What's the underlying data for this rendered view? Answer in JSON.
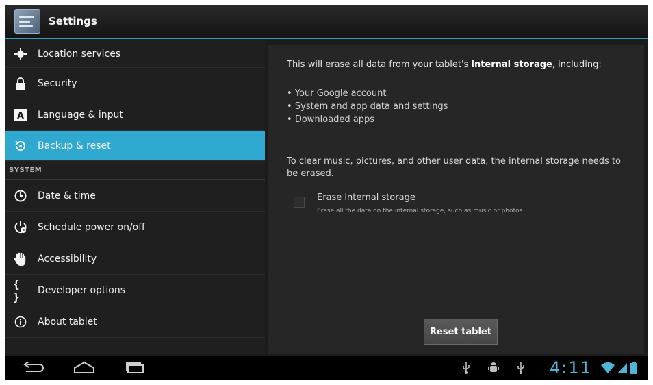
{
  "app": {
    "title": "Settings"
  },
  "sidebar": {
    "items": [
      {
        "label": "Location services",
        "icon": "location-icon"
      },
      {
        "label": "Security",
        "icon": "lock-icon"
      },
      {
        "label": "Language & input",
        "icon": "keyboard-a-icon"
      },
      {
        "label": "Backup & reset",
        "icon": "backup-icon",
        "selected": true
      }
    ],
    "system_header": "SYSTEM",
    "system_items": [
      {
        "label": "Date & time",
        "icon": "clock-icon"
      },
      {
        "label": "Schedule power on/off",
        "icon": "schedule-power-icon"
      },
      {
        "label": "Accessibility",
        "icon": "hand-icon"
      },
      {
        "label": "Developer options",
        "icon": "braces-icon"
      },
      {
        "label": "About tablet",
        "icon": "info-icon"
      }
    ]
  },
  "main": {
    "intro_prefix": "This will erase all data from your tablet's ",
    "intro_bold": "internal storage",
    "intro_suffix": ", including:",
    "bullets": [
      "Your Google account",
      "System and app data and settings",
      "Downloaded apps"
    ],
    "note": "To clear music, pictures, and other user data, the internal storage needs to be erased.",
    "erase_title": "Erase internal storage",
    "erase_subtitle": "Erase all the data on the internal storage, such as music or photos",
    "reset_button": "Reset tablet"
  },
  "statusbar": {
    "clock": "4:11"
  },
  "colors": {
    "accent": "#2fa9cf",
    "clock": "#4fb5d8"
  }
}
